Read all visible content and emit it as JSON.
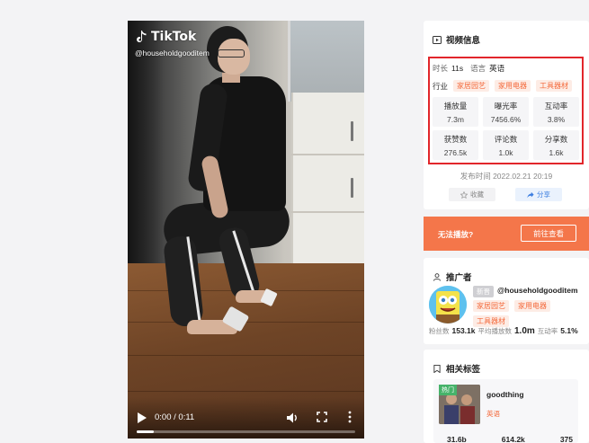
{
  "player": {
    "watermark_brand": "TikTok",
    "watermark_handle": "@householdgooditem",
    "time": "0:00 / 0:11",
    "progress": 0.08
  },
  "video_info": {
    "title": "视频信息",
    "duration_label": "时长",
    "duration_value": "11s",
    "language_label": "语言",
    "language_value": "英语",
    "industry_label": "行业",
    "industry_tags": [
      "家居园艺",
      "家用电器",
      "工具器材"
    ],
    "stats": [
      {
        "label": "播放量",
        "value": "7.3m"
      },
      {
        "label": "曝光率",
        "value": "7456.6%"
      },
      {
        "label": "互动率",
        "value": "3.8%"
      },
      {
        "label": "获赞数",
        "value": "276.5k"
      },
      {
        "label": "评论数",
        "value": "1.0k"
      },
      {
        "label": "分享数",
        "value": "1.6k"
      }
    ],
    "publish_time": "发布时间 2022.02.21 20:19",
    "collect_label": "收藏",
    "share_label": "分享"
  },
  "banner": {
    "text": "无法播放?",
    "button": "前往查看"
  },
  "promoter": {
    "title": "推广者",
    "badge": "新晋",
    "name": "@householdgooditem",
    "tags": [
      "家居园艺",
      "家用电器",
      "工具器材"
    ],
    "fans_label": "粉丝数",
    "fans_value": "153.1k",
    "avg_play_label": "平均播放数",
    "avg_play_value": "1.0m",
    "interact_label": "互动率",
    "interact_value": "5.1%"
  },
  "related_tags": {
    "title": "相关标签",
    "hot_badge": "热门",
    "tag_name": "goodthing",
    "tag_lang": "英语",
    "stats": [
      "31.6b",
      "614.2k",
      "375"
    ]
  },
  "colors": {
    "accent": "#f4764a",
    "highlight_border": "#e2262b",
    "tag_text": "#f46a3c",
    "share_blue": "#3b7de0"
  }
}
